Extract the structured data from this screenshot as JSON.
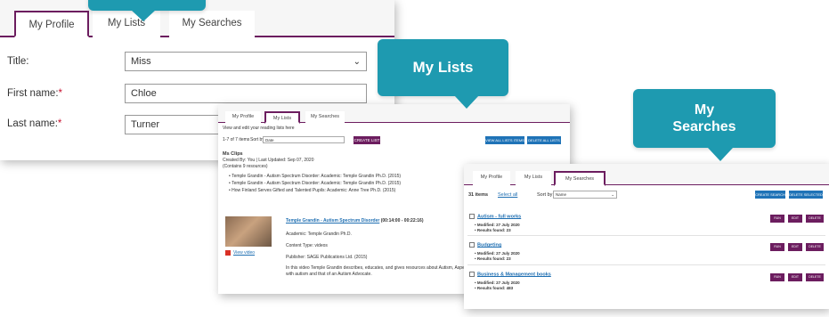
{
  "profile_panel": {
    "tabs": [
      {
        "label": "My Profile",
        "active": true
      },
      {
        "label": "My Lists",
        "active": false
      },
      {
        "label": "My Searches",
        "active": false
      }
    ],
    "fields": [
      {
        "label": "Title:",
        "required": false,
        "value": "Miss",
        "type": "select"
      },
      {
        "label": "First name:",
        "required": true,
        "value": "Chloe",
        "type": "text"
      },
      {
        "label": "Last name:",
        "required": true,
        "value": "Turner",
        "type": "text"
      }
    ],
    "required_marker": "*"
  },
  "callouts": {
    "lists": "My Lists",
    "searches_line1": "My",
    "searches_line2": "Searches"
  },
  "lists_panel": {
    "tabs": [
      {
        "label": "My Profile",
        "active": false
      },
      {
        "label": "My Lists",
        "active": true
      },
      {
        "label": "My Searches",
        "active": false
      }
    ],
    "intro": "View and edit your reading lists here",
    "count": "1-7 of 7 items",
    "sort_label": "Sort by",
    "sort_value": "Date",
    "create_button": "CREATE LIST",
    "view_all_button": "VIEW ALL LISTS ITEMS",
    "delete_all_button": "DELETE ALL LISTS",
    "list_title": "Ms Clips",
    "created_line": "Created By: You | Last Updated: Sep 07, 2020",
    "contains_line": "(Contains 9 resources)",
    "bullets": [
      "Temple Grandin - Autism Spectrum Disorder: Academic: Temple Grandin Ph.D. (2015)",
      "Temple Grandin - Autism Spectrum Disorder: Academic: Temple Grandin Ph.D. (2015)",
      "How Finland Serves Gifted and Talented Pupils: Academic: Anne Tree Ph.D. (2015)"
    ],
    "video_title": "Temple Grandin - Autism Spectrum Disorder",
    "video_time": "(00:14:00 - 00:22:16)",
    "academic_line": "Academic: Temple Grandin Ph.D.",
    "content_type": "Content Type: videos",
    "publisher": "Publisher: SAGE Publications Ltd. (2015)",
    "description": "In this video Temple Grandin describes, educates, and gives resources about Autism, Asperger's, and the perspective of a person living with autism and that of an Autism Advocate.",
    "view_video": "View video"
  },
  "searches_panel": {
    "tabs": [
      {
        "label": "My Profile",
        "active": false
      },
      {
        "label": "My Lists",
        "active": false
      },
      {
        "label": "My Searches",
        "active": true
      }
    ],
    "count": "31 items",
    "select_all": "Select all",
    "sort_label": "Sort by",
    "sort_value": "Name",
    "create_button": "CREATE SEARCH",
    "delete_selected_button": "DELETE SELECTED",
    "row_buttons": [
      "RUN",
      "EDIT",
      "DELETE"
    ],
    "rows": [
      {
        "title": "Autism - full works",
        "modified": "Modified: 27 July 2020",
        "results": "Results found: 23"
      },
      {
        "title": "Budgeting",
        "modified": "Modified: 27 July 2020",
        "results": "Results found: 23"
      },
      {
        "title": "Business & Management books",
        "modified": "Modified: 27 July 2020",
        "results": "Results found: 483"
      }
    ]
  },
  "colors": {
    "brand_purple": "#6c1d5f",
    "callout_teal": "#1e9ab0",
    "link_blue": "#1f6fb2",
    "required_red": "#c8102e"
  }
}
